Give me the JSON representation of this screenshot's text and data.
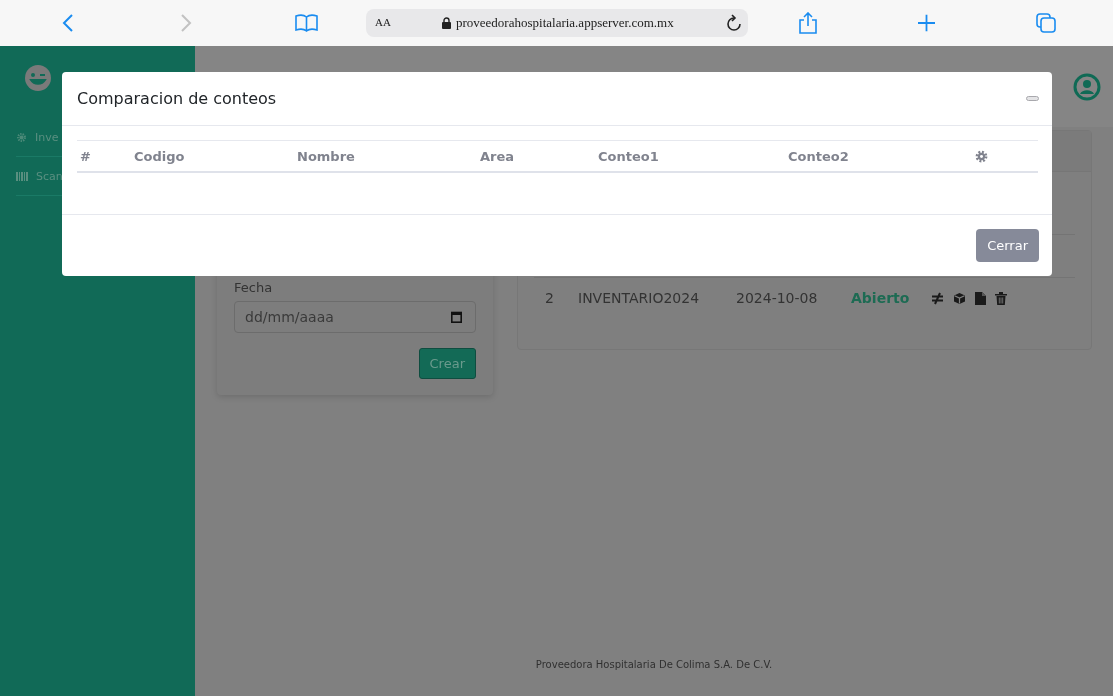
{
  "browser": {
    "text_size": "AA",
    "url": "proveedorahospitalaria.appserver.com.mx"
  },
  "sidebar": {
    "items": [
      {
        "label": "Inve"
      },
      {
        "label": "Scan"
      }
    ]
  },
  "form": {
    "date_label": "Fecha",
    "date_placeholder": "dd/mm/aaaa",
    "submit": "Crear"
  },
  "inventories": {
    "rows": [
      {
        "number": "2",
        "name": "INVENTARIO2024",
        "date": "2024-10-08",
        "status": "Abierto"
      }
    ]
  },
  "footer": "Proveedora Hospitalaria De Colima S.A. De C.V.",
  "modal": {
    "title": "Comparacion de conteos",
    "columns": [
      "#",
      "Codigo",
      "Nombre",
      "Area",
      "Conteo1",
      "Conteo2"
    ],
    "close_button": "Cerrar"
  }
}
